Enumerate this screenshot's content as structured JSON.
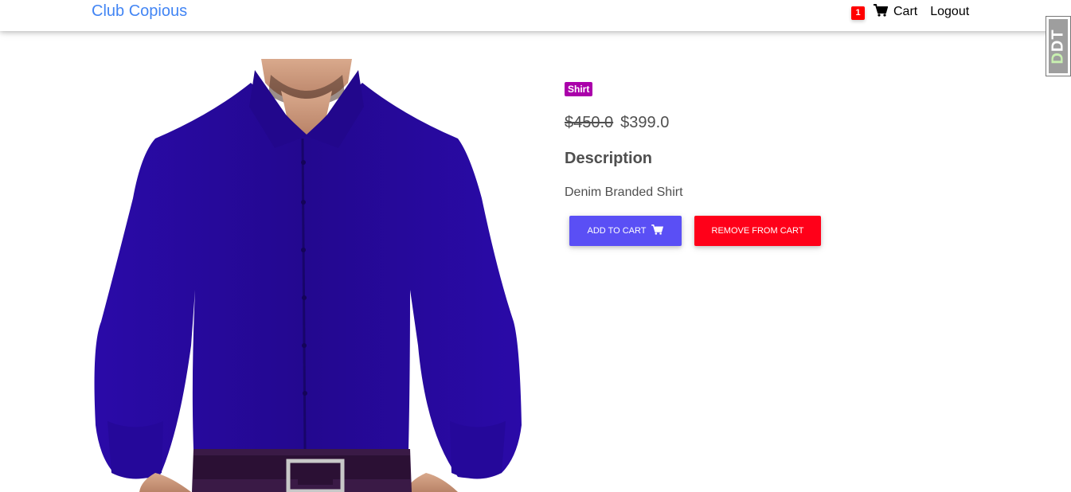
{
  "navbar": {
    "brand": "Club Copious",
    "cart_count": "1",
    "cart_label": "Cart",
    "logout_label": "Logout"
  },
  "extension_badge": {
    "text_prefix": "D",
    "text_main": "DT"
  },
  "product": {
    "category_badge": "Shirt",
    "old_price": "$450.0",
    "price": "$399.0",
    "description_heading": "Description",
    "description": "Denim Branded Shirt",
    "image_alt": "Blue shirt product image"
  },
  "actions": {
    "add_to_cart": "ADD TO CART",
    "remove_from_cart": "REMOVE FROM CART"
  },
  "colors": {
    "brand": "#4285f4",
    "cart_count_bg": "#ff0000",
    "badge_bg": "#aa00aa",
    "add_button": "#5a4ff5",
    "remove_button": "#ff0019",
    "shirt": "#2a0a9e"
  },
  "icons": {
    "cart": "shopping-cart-icon"
  }
}
